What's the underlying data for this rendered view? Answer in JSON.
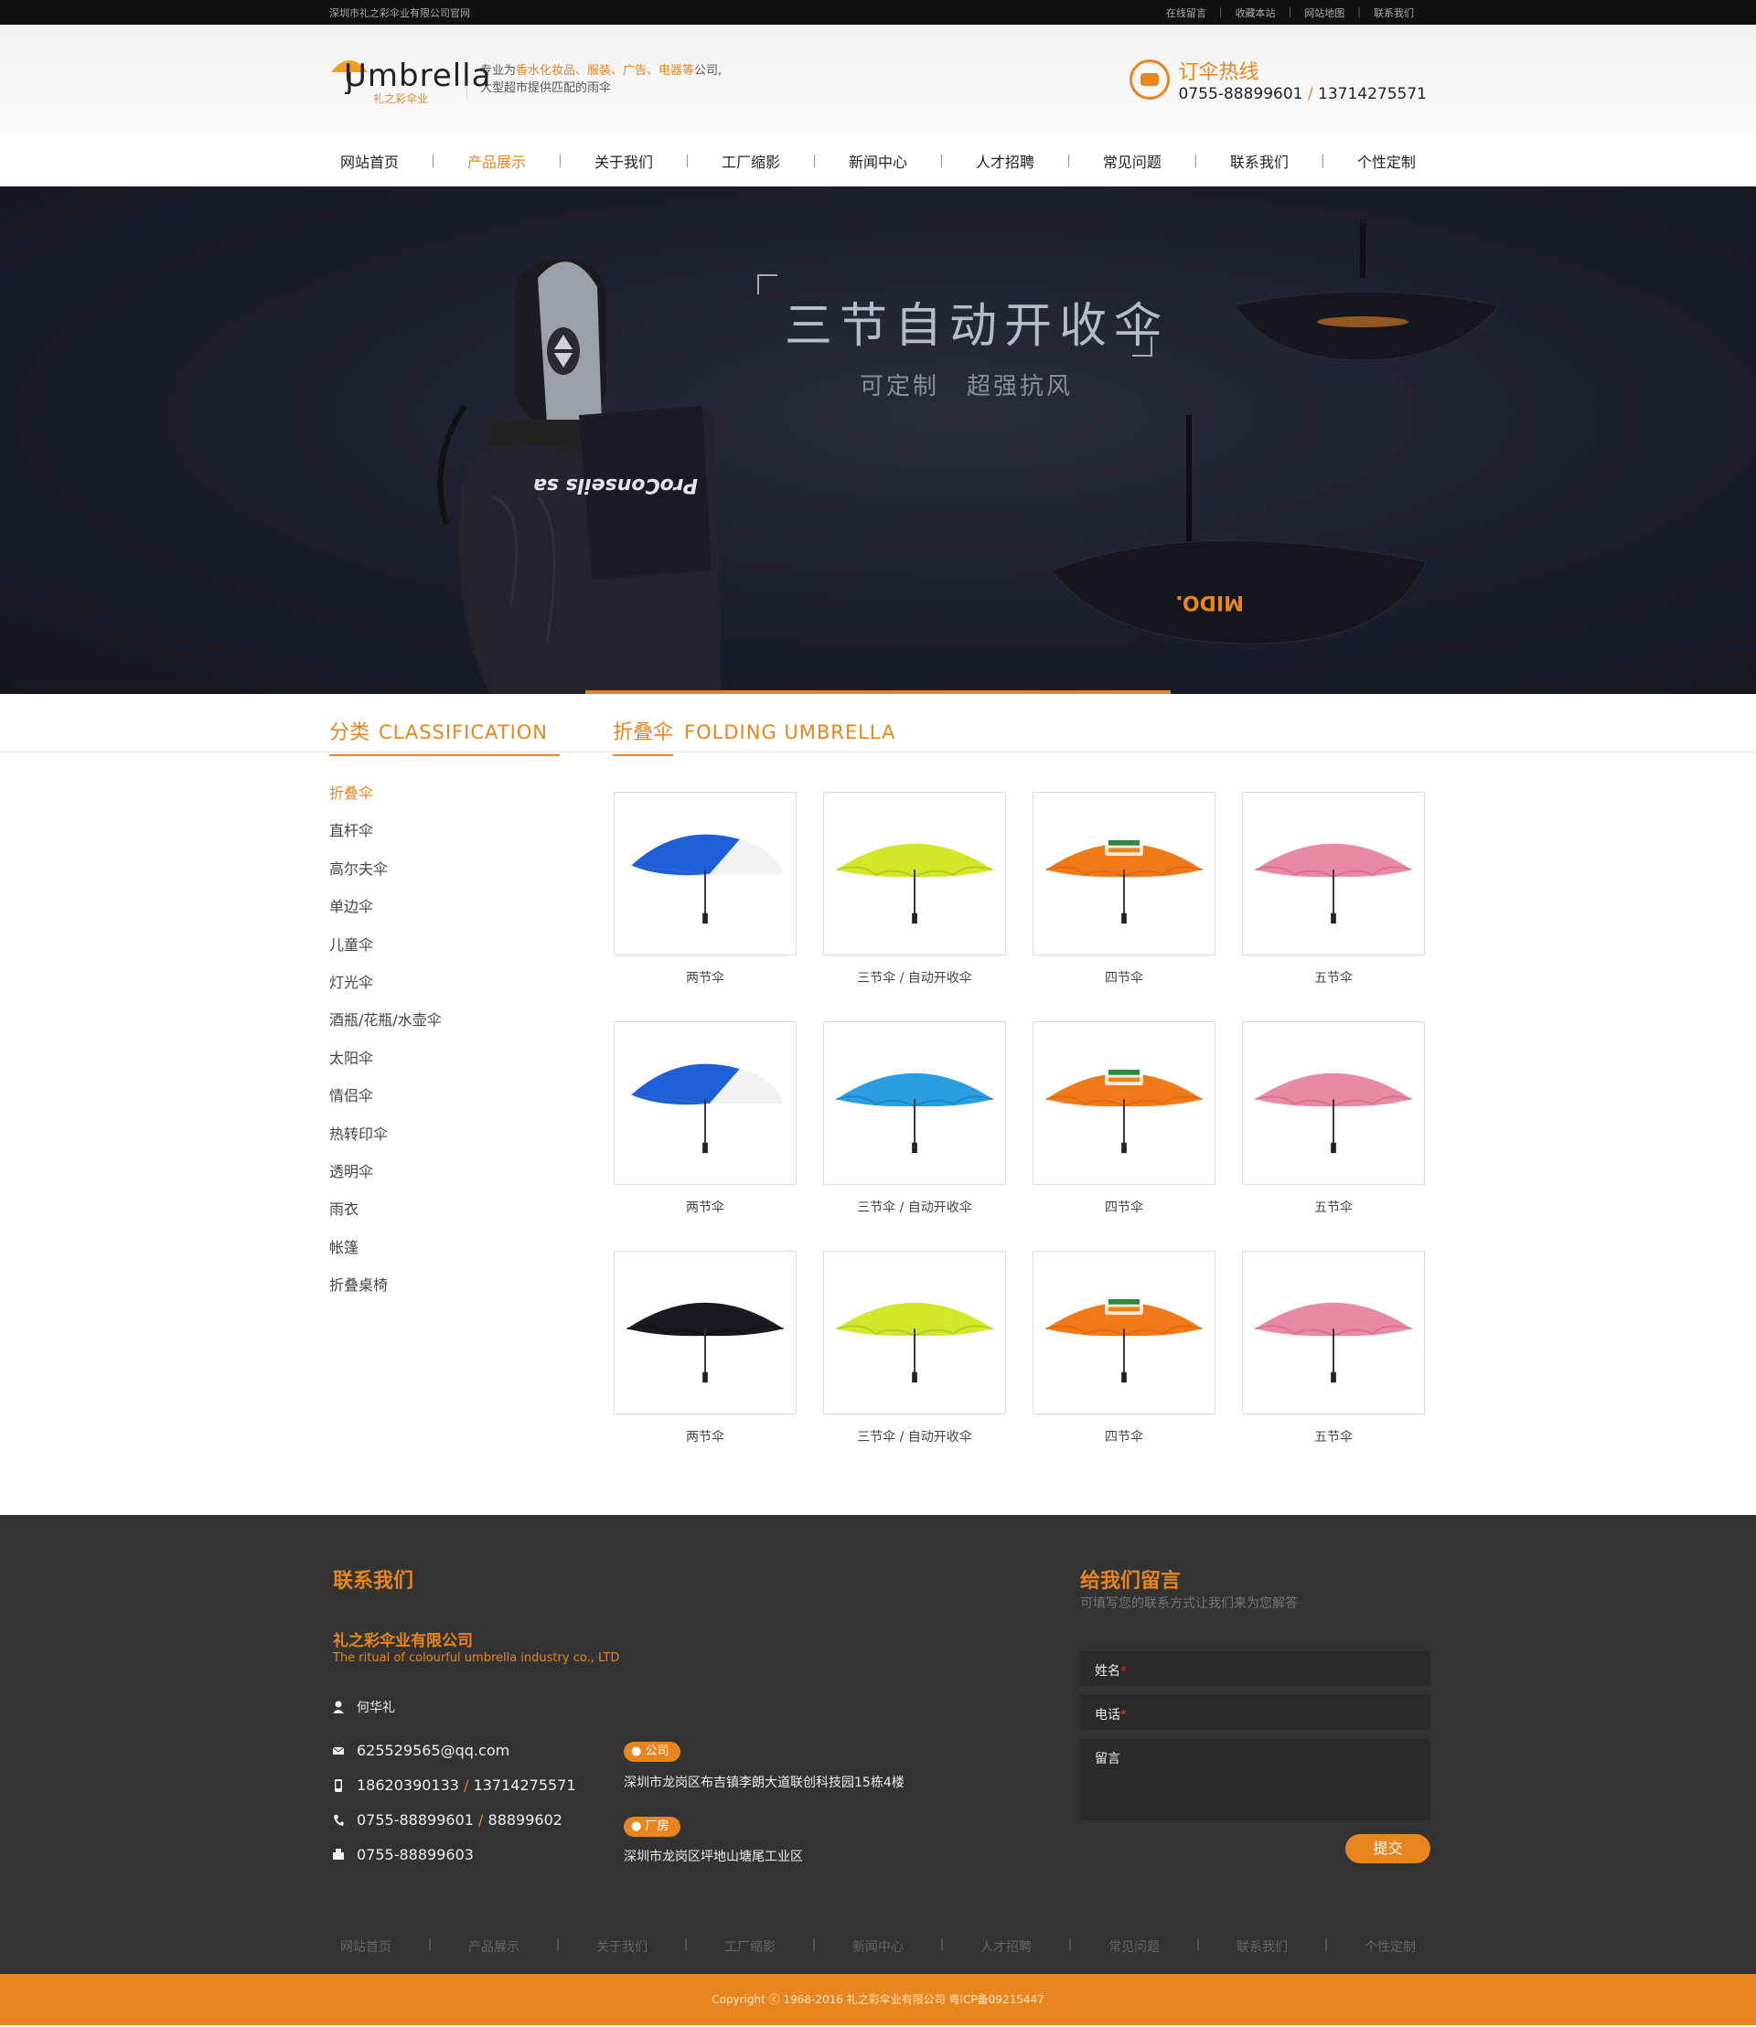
{
  "topbar": {
    "company": "深圳市礼之彩伞业有限公司官网",
    "links": [
      "在线留言",
      "收藏本站",
      "网站地图",
      "联系我们"
    ]
  },
  "header": {
    "logo_text": "Umbrella",
    "logo_cn": "礼之彩伞业",
    "slogan_line1_prefix": "专业为",
    "slogan_line1_highlight": "香水化妆品、服装、广告、电器等",
    "slogan_line1_suffix": "公司,",
    "slogan_line2": "大型超市提供匹配的雨伞",
    "hotline_title": "订伞热线",
    "hotline_num1": "0755-88899601",
    "hotline_sep": "/",
    "hotline_num2": "13714275571"
  },
  "nav": {
    "items": [
      "网站首页",
      "产品展示",
      "关于我们",
      "工厂缩影",
      "新闻中心",
      "人才招聘",
      "常见问题",
      "联系我们",
      "个性定制"
    ],
    "active": "产品展示"
  },
  "banner": {
    "title": "三节自动开收伞",
    "sub1": "可定制",
    "sub2": "超强抗风",
    "brand_text": "MIDO.",
    "umbrella_text": "ProConseils sa"
  },
  "sidebar": {
    "title_cn": "分类",
    "title_en": "CLASSIFICATION",
    "items": [
      "折叠伞",
      "直杆伞",
      "高尔夫伞",
      "单边伞",
      "儿童伞",
      "灯光伞",
      "酒瓶/花瓶/水壶伞",
      "太阳伞",
      "情侣伞",
      "热转印伞",
      "透明伞",
      "雨衣",
      "帐篷",
      "折叠桌椅"
    ],
    "active": "折叠伞"
  },
  "main": {
    "title_cn": "折叠伞",
    "title_en": "FOLDING UMBRELLA",
    "products": [
      {
        "caption": "两节伞",
        "canopy": "#1e5fd8",
        "accent": "#f2f2f2",
        "style": "split"
      },
      {
        "caption": "三节伞 / 自动开收伞",
        "canopy": "#d4e62a",
        "accent": "#b8c91a",
        "style": "solid"
      },
      {
        "caption": "四节伞",
        "canopy": "#f07a18",
        "accent": "#e06a10",
        "style": "print"
      },
      {
        "caption": "五节伞",
        "canopy": "#e98aa4",
        "accent": "#d9708c",
        "style": "solid"
      },
      {
        "caption": "两节伞",
        "canopy": "#1e5fd8",
        "accent": "#f2f2f2",
        "style": "split"
      },
      {
        "caption": "三节伞 / 自动开收伞",
        "canopy": "#2a9ee0",
        "accent": "#1a86c8",
        "style": "solid"
      },
      {
        "caption": "四节伞",
        "canopy": "#f07a18",
        "accent": "#e06a10",
        "style": "print"
      },
      {
        "caption": "五节伞",
        "canopy": "#e98aa4",
        "accent": "#d9708c",
        "style": "solid"
      },
      {
        "caption": "两节伞",
        "canopy": "#1a1a22",
        "accent": "#111",
        "style": "solid"
      },
      {
        "caption": "三节伞 / 自动开收伞",
        "canopy": "#d4e62a",
        "accent": "#b8c91a",
        "style": "solid"
      },
      {
        "caption": "四节伞",
        "canopy": "#f07a18",
        "accent": "#e06a10",
        "style": "print"
      },
      {
        "caption": "五节伞",
        "canopy": "#e98aa4",
        "accent": "#d9708c",
        "style": "solid"
      }
    ]
  },
  "footer": {
    "contact_title": "联系我们",
    "company_cn": "礼之彩伞业有限公司",
    "company_en": "The ritual of colourful umbrella industry co., LTD",
    "person": "何华礼",
    "email": "625529565@qq.com",
    "mobile1": "18620390133",
    "mobile2": "13714275571",
    "tel1": "0755-88899601",
    "tel2": "88899602",
    "fax": "0755-88899603",
    "office_tag": "公司",
    "office_addr": "深圳市龙岗区布吉镇李朗大道联创科技园15栋4楼",
    "factory_tag": "厂房",
    "factory_addr": "深圳市龙岗区坪地山塘尾工业区",
    "msg_title": "给我们留言",
    "msg_sub": "可填写您的联系方式让我们来为您解答",
    "name_label": "姓名",
    "phone_label": "电话",
    "message_label": "留言",
    "required_mark": "*",
    "submit_label": "提交",
    "nav": [
      "网站首页",
      "产品展示",
      "关于我们",
      "工厂缩影",
      "新闻中心",
      "人才招聘",
      "常见问题",
      "联系我们",
      "个性定制"
    ],
    "copyright": "Copyright ⓒ 1968-2016 礼之彩伞业有限公司 粤ICP备09215447"
  },
  "colors": {
    "accent": "#e8851e",
    "footer_bg": "#333333",
    "banner_bg": "#1c1d2c"
  }
}
